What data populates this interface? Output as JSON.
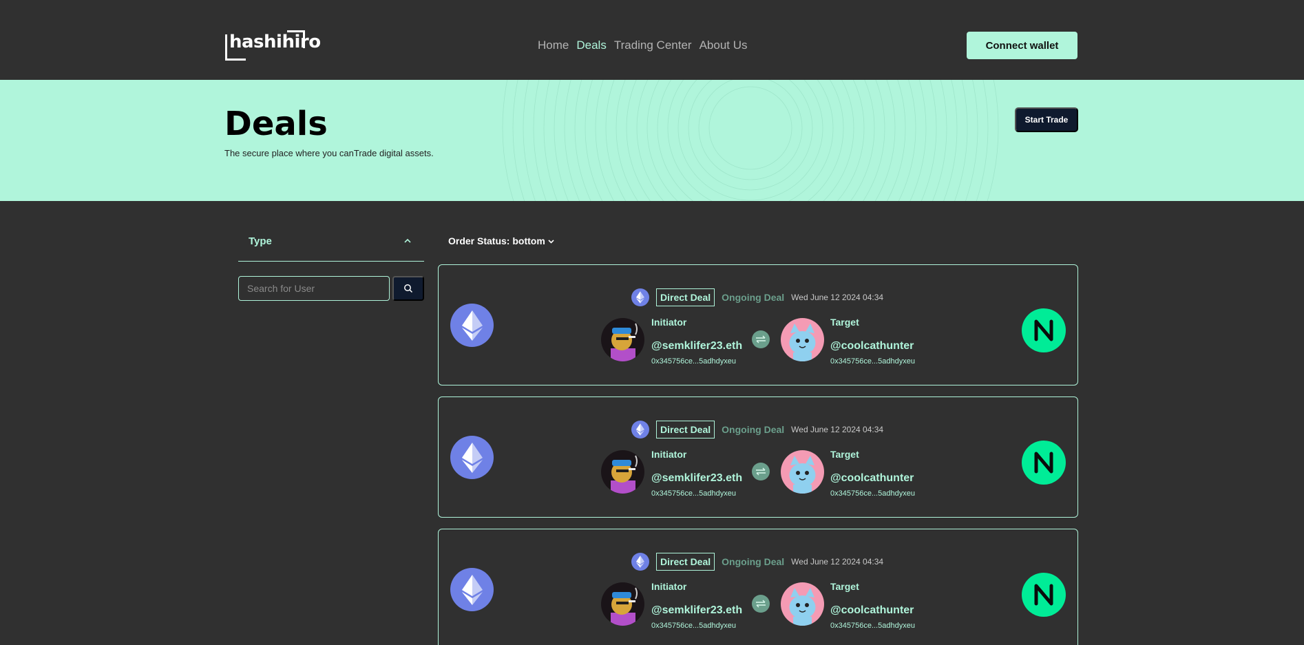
{
  "header": {
    "logo_text": "hashihiro",
    "nav": [
      "Home",
      "Deals",
      "Trading Center",
      "About Us"
    ],
    "active_nav": "Deals",
    "connect_wallet_label": "Connect wallet"
  },
  "hero": {
    "title": "Deals",
    "subtitle": "The secure place where you canTrade digital assets.",
    "start_trade_label": "Start Trade"
  },
  "sidebar": {
    "type_label": "Type",
    "search_placeholder": "Search for User"
  },
  "order_status_label": "Order Status: bottom",
  "deals": [
    {
      "badge": "Direct Deal",
      "status": "Ongoing Deal",
      "date": "Wed June 12 2024 04:34",
      "initiator": {
        "role": "Initiator",
        "name": "@semklifer23.eth",
        "address": "0x345756ce...5adhdyxeu"
      },
      "target": {
        "role": "Target",
        "name": "@coolcathunter",
        "address": "0x345756ce...5adhdyxeu"
      }
    },
    {
      "badge": "Direct Deal",
      "status": "Ongoing Deal",
      "date": "Wed June 12 2024 04:34",
      "initiator": {
        "role": "Initiator",
        "name": "@semklifer23.eth",
        "address": "0x345756ce...5adhdyxeu"
      },
      "target": {
        "role": "Target",
        "name": "@coolcathunter",
        "address": "0x345756ce...5adhdyxeu"
      }
    },
    {
      "badge": "Direct Deal",
      "status": "Ongoing Deal",
      "date": "Wed June 12 2024 04:34",
      "initiator": {
        "role": "Initiator",
        "name": "@semklifer23.eth",
        "address": "0x345756ce...5adhdyxeu"
      },
      "target": {
        "role": "Target",
        "name": "@coolcathunter",
        "address": "0x345756ce...5adhdyxeu"
      }
    }
  ],
  "colors": {
    "background": "#303030",
    "accent": "#b0f5db",
    "dark_button": "#0f1a2e",
    "eth": "#6f81e6",
    "near": "#00ec97",
    "muted_green": "#6b9f8c"
  },
  "icons": {
    "eth": "ethereum-icon",
    "near": "near-icon",
    "swap": "swap-arrows-icon",
    "search": "search-icon",
    "chevron_up": "chevron-up-icon",
    "chevron_down": "chevron-down-icon"
  }
}
